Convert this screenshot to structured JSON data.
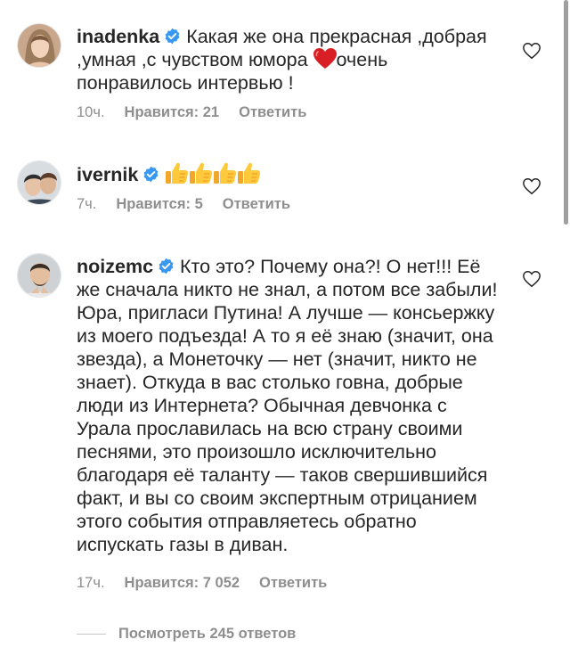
{
  "comments": [
    {
      "username": "inadenka",
      "text_before_emoji": "Какая же она прекрасная ,добрая ,умная ,с чувством юмора ",
      "text_after_emoji": "очень понравилось интервью !",
      "emoji": "red-heart",
      "time": "10ч.",
      "likes": "Нравится: 21",
      "reply": "Ответить"
    },
    {
      "username": "ivernik",
      "emoji": "thumbs-up-x4",
      "time": "7ч.",
      "likes": "Нравится: 5",
      "reply": "Ответить"
    },
    {
      "username": "noizemc",
      "text": "Кто это? Почему она?! О нет!!! Её же сначала никто не знал, а потом все забыли! Юра, пригласи Путина! А лучше — консьержку из моего подъезда! А то я её знаю (значит, она звезда), а Монеточку — нет (значит, никто не знает). Откуда в вас столько говна, добрые люди из Интернета? Обычная девчонка с Урала прославилась на всю страну своими песнями, это произошло исключительно благодаря её таланту — таков свершившийся факт, и вы со своим экспертным отрицанием этого события отправляетесь обратно испускать газы в диван.",
      "time": "17ч.",
      "likes": "Нравится: 7 052",
      "reply": "Ответить"
    }
  ],
  "view_replies": "Посмотреть 245 ответов",
  "colors": {
    "text": "#262626",
    "meta": "#8e8e8e",
    "verified": "#3897f0",
    "heart": "#ed4956"
  },
  "icons": [
    "verified-badge-icon",
    "heart-outline-icon",
    "red-heart-emoji",
    "thumbs-up-emoji"
  ]
}
